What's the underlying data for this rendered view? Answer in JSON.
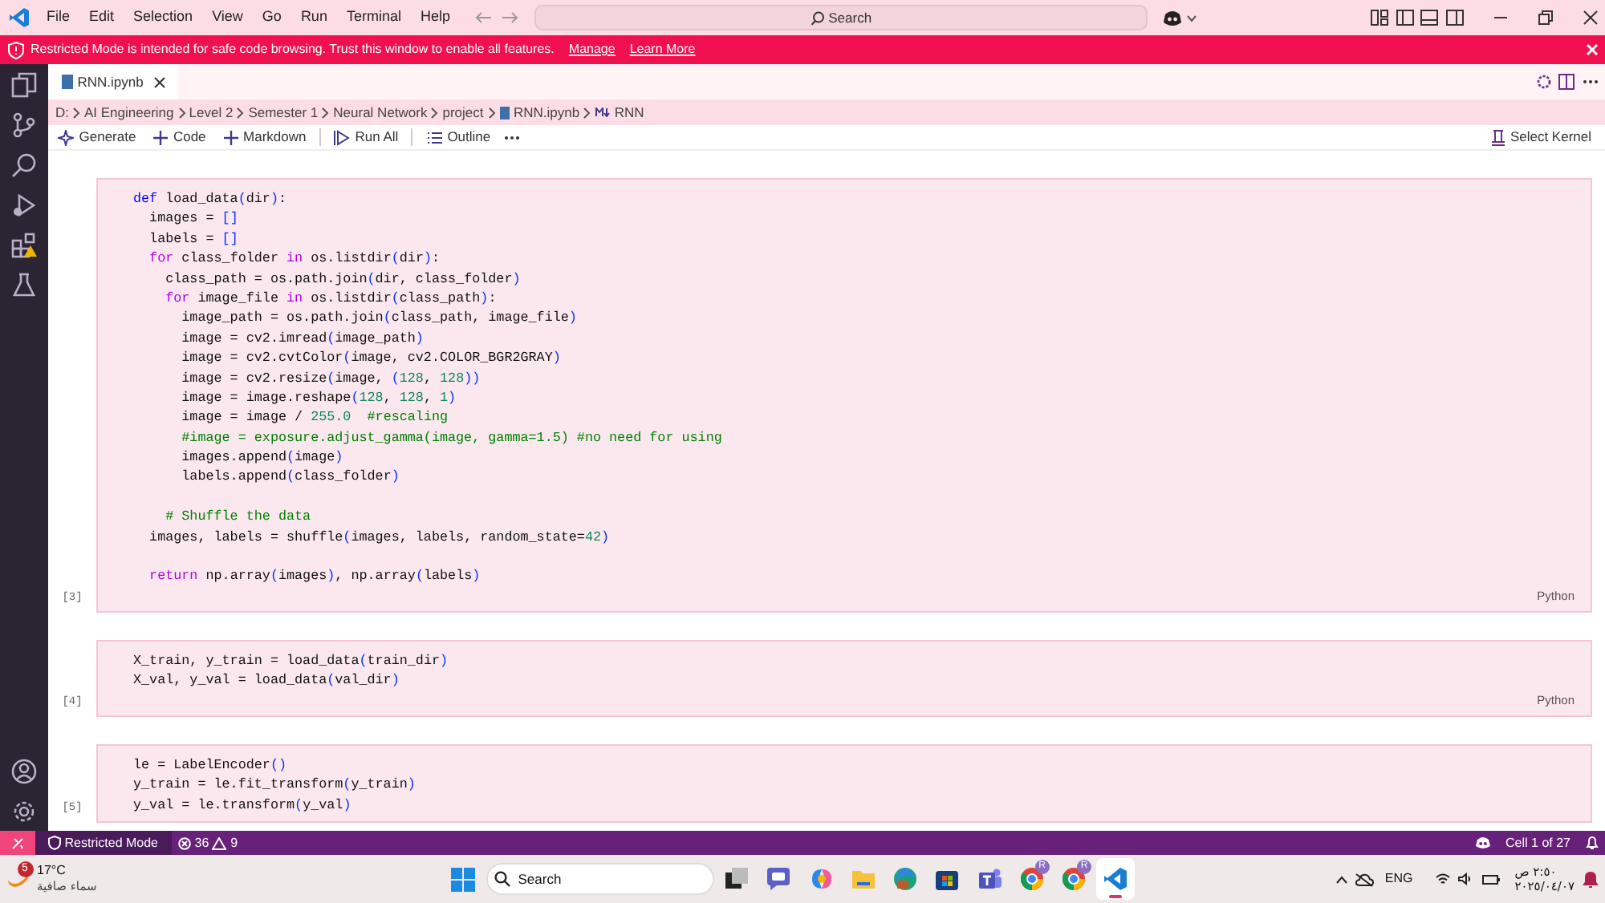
{
  "menu": [
    "File",
    "Edit",
    "Selection",
    "View",
    "Go",
    "Run",
    "Terminal",
    "Help"
  ],
  "command_center": "Search",
  "banner": {
    "message": "Restricted Mode is intended for safe code browsing. Trust this window to enable all features.",
    "links": [
      "Manage",
      "Learn More"
    ]
  },
  "tabs": [
    {
      "label": "RNN.ipynb",
      "selected": true
    }
  ],
  "breadcrumb": [
    "D:",
    "AI Engineering",
    "Level 2",
    "Semester 1",
    "Neural Network",
    "project",
    "RNN.ipynb",
    "RNN"
  ],
  "toolbar": [
    {
      "label": "Generate",
      "kind": "sparkle"
    },
    {
      "label": "Code",
      "kind": "add"
    },
    {
      "label": "Markdown",
      "kind": "add"
    },
    {
      "label": "Run All",
      "kind": "run"
    },
    {
      "label": "Outline",
      "kind": "outline"
    }
  ],
  "kernel": "Select Kernel",
  "cells": [
    {
      "count": "[3]",
      "language": "Python",
      "lines": [
        {
          "tokens": [
            {
              "text": "def",
              "kind": "def"
            },
            {
              "text": " load_data"
            },
            {
              "text": "(",
              "kind": "br"
            },
            {
              "text": "dir"
            },
            {
              "text": ")",
              "kind": "br"
            },
            {
              "text": ":"
            }
          ]
        },
        {
          "tokens": [
            {
              "text": "  images = "
            },
            {
              "text": "[]",
              "kind": "br"
            }
          ]
        },
        {
          "tokens": [
            {
              "text": "  labels = "
            },
            {
              "text": "[]",
              "kind": "br"
            }
          ]
        },
        {
          "tokens": [
            {
              "text": "  for",
              "kind": "ctrl"
            },
            {
              "text": " class_folder "
            },
            {
              "text": "in",
              "kind": "ctrl"
            },
            {
              "text": " os.listdir"
            },
            {
              "text": "(",
              "kind": "br"
            },
            {
              "text": "dir"
            },
            {
              "text": ")",
              "kind": "br"
            },
            {
              "text": ":"
            }
          ]
        },
        {
          "tokens": [
            {
              "text": "    class_path = os.path.join"
            },
            {
              "text": "(",
              "kind": "br"
            },
            {
              "text": "dir, class_folder"
            },
            {
              "text": ")",
              "kind": "br"
            }
          ]
        },
        {
          "tokens": [
            {
              "text": "    for",
              "kind": "ctrl"
            },
            {
              "text": " image_file "
            },
            {
              "text": "in",
              "kind": "ctrl"
            },
            {
              "text": " os.listdir"
            },
            {
              "text": "(",
              "kind": "br"
            },
            {
              "text": "class_path"
            },
            {
              "text": ")",
              "kind": "br"
            },
            {
              "text": ":"
            }
          ]
        },
        {
          "tokens": [
            {
              "text": "      image_path = os.path.join"
            },
            {
              "text": "(",
              "kind": "br"
            },
            {
              "text": "class_path, image_file"
            },
            {
              "text": ")",
              "kind": "br"
            }
          ]
        },
        {
          "tokens": [
            {
              "text": "      image = cv2.imread"
            },
            {
              "text": "(",
              "kind": "br"
            },
            {
              "text": "image_path"
            },
            {
              "text": ")",
              "kind": "br"
            }
          ]
        },
        {
          "tokens": [
            {
              "text": "      image = cv2.cvtColor"
            },
            {
              "text": "(",
              "kind": "br"
            },
            {
              "text": "image, cv2.COLOR_BGR2GRAY"
            },
            {
              "text": ")",
              "kind": "br"
            }
          ]
        },
        {
          "tokens": [
            {
              "text": "      image = cv2.resize"
            },
            {
              "text": "(",
              "kind": "br"
            },
            {
              "text": "image, "
            },
            {
              "text": "(",
              "kind": "br"
            },
            {
              "text": "128",
              "kind": "num"
            },
            {
              "text": ", "
            },
            {
              "text": "128",
              "kind": "num"
            },
            {
              "text": "))",
              "kind": "br"
            }
          ]
        },
        {
          "tokens": [
            {
              "text": "      image = image.reshape"
            },
            {
              "text": "(",
              "kind": "br"
            },
            {
              "text": "128",
              "kind": "num"
            },
            {
              "text": ", "
            },
            {
              "text": "128",
              "kind": "num"
            },
            {
              "text": ", "
            },
            {
              "text": "1",
              "kind": "num"
            },
            {
              "text": ")",
              "kind": "br"
            }
          ]
        },
        {
          "tokens": [
            {
              "text": "      image = image / "
            },
            {
              "text": "255.0",
              "kind": "num"
            },
            {
              "text": "  #rescaling",
              "kind": "com"
            }
          ]
        },
        {
          "tokens": [
            {
              "text": "      #image = exposure.adjust_gamma(image, gamma=1.5) #no need for using",
              "kind": "com"
            }
          ]
        },
        {
          "tokens": [
            {
              "text": "      images.append"
            },
            {
              "text": "(",
              "kind": "br"
            },
            {
              "text": "image"
            },
            {
              "text": ")",
              "kind": "br"
            }
          ]
        },
        {
          "tokens": [
            {
              "text": "      labels.append"
            },
            {
              "text": "(",
              "kind": "br"
            },
            {
              "text": "class_folder"
            },
            {
              "text": ")",
              "kind": "br"
            }
          ]
        },
        {
          "gap_before": true,
          "tokens": [
            {
              "text": "    # Shuffle the data",
              "kind": "com"
            }
          ]
        },
        {
          "tokens": [
            {
              "text": "  images, labels = shuffle"
            },
            {
              "text": "(",
              "kind": "br"
            },
            {
              "text": "images, labels, random_state="
            },
            {
              "text": "42",
              "kind": "num"
            },
            {
              "text": ")",
              "kind": "br"
            }
          ]
        },
        {
          "gap_before": true,
          "tokens": [
            {
              "text": "  return",
              "kind": "ctrl"
            },
            {
              "text": " np.array"
            },
            {
              "text": "(",
              "kind": "br"
            },
            {
              "text": "images"
            },
            {
              "text": ")",
              "kind": "br"
            },
            {
              "text": ", np.array"
            },
            {
              "text": "(",
              "kind": "br"
            },
            {
              "text": "labels"
            },
            {
              "text": ")",
              "kind": "br"
            }
          ]
        }
      ]
    },
    {
      "count": "[4]",
      "language": "Python",
      "lines": [
        {
          "tokens": [
            {
              "text": "X_train, y_train = load_data"
            },
            {
              "text": "(",
              "kind": "br"
            },
            {
              "text": "train_dir"
            },
            {
              "text": ")",
              "kind": "br"
            }
          ]
        },
        {
          "tokens": [
            {
              "text": "X_val, y_val = load_data"
            },
            {
              "text": "(",
              "kind": "br"
            },
            {
              "text": "val_dir"
            },
            {
              "text": ")",
              "kind": "br"
            }
          ]
        }
      ]
    },
    {
      "count": "[5]",
      "lines": [
        {
          "tokens": [
            {
              "text": "le = LabelEncoder"
            },
            {
              "text": "()",
              "kind": "br"
            }
          ]
        },
        {
          "tokens": [
            {
              "text": "y_train = le.fit_transform"
            },
            {
              "text": "(",
              "kind": "br"
            },
            {
              "text": "y_train"
            },
            {
              "text": ")",
              "kind": "br"
            }
          ]
        },
        {
          "tokens": [
            {
              "text": "y_val = le.transform"
            },
            {
              "text": "(",
              "kind": "br"
            },
            {
              "text": "y_val"
            },
            {
              "text": ")",
              "kind": "br"
            }
          ]
        }
      ]
    }
  ],
  "status_bar": {
    "mode": "Restricted Mode",
    "errors": "36",
    "warnings": "9",
    "cell": "Cell 1 of 27"
  },
  "taskbar": {
    "weather_badge": "5",
    "temperature": "17°C",
    "weather": "سماء صافية",
    "search": "Search",
    "apps": [
      {
        "kind": "taskview",
        "selected": false
      },
      {
        "kind": "chat",
        "selected": false
      },
      {
        "kind": "copilot",
        "selected": false
      },
      {
        "kind": "folder",
        "selected": false
      },
      {
        "kind": "edge",
        "selected": false
      },
      {
        "kind": "store",
        "selected": false
      },
      {
        "kind": "teams",
        "selected": false
      },
      {
        "kind": "chrome",
        "badge": "R",
        "selected": false
      },
      {
        "kind": "chrome",
        "badge": "R",
        "selected": false
      },
      {
        "kind": "vscode",
        "selected": true
      }
    ],
    "language": "ENG",
    "time": "٢:٥٠ ص",
    "date": "٢٠٢٥/٠٤/٠٧"
  }
}
